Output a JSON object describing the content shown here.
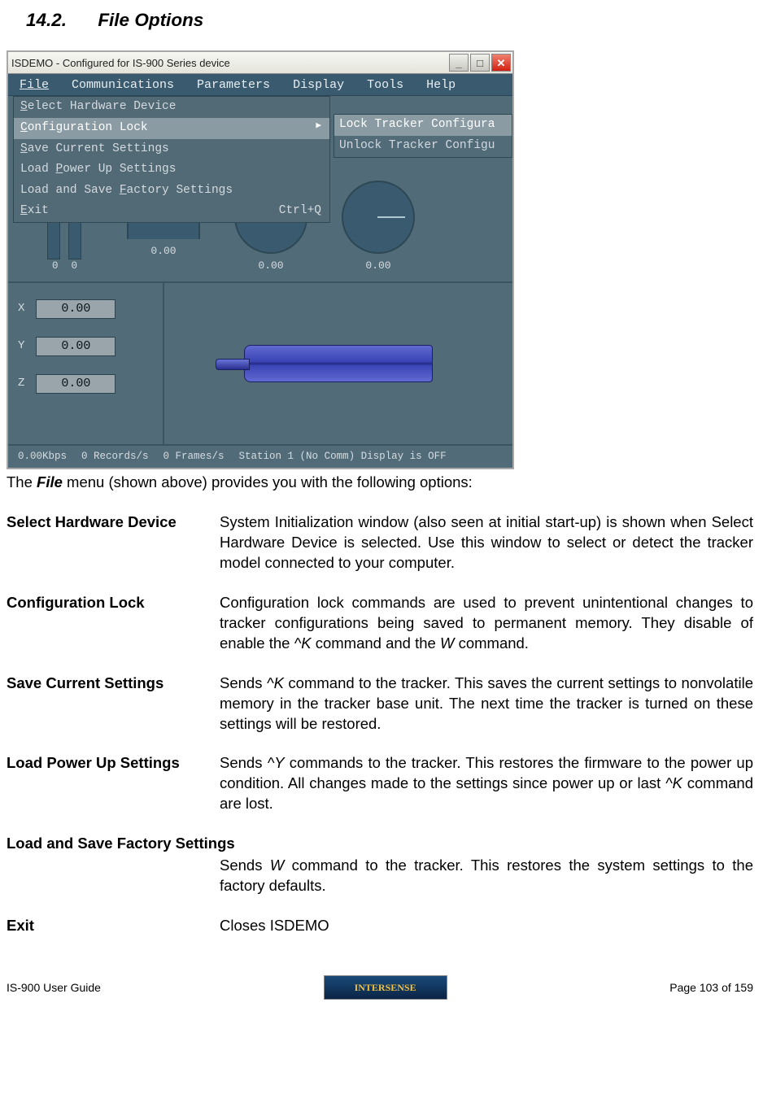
{
  "heading": {
    "number": "14.2.",
    "title": "File Options"
  },
  "window": {
    "title": "ISDEMO - Configured for IS-900 Series device",
    "menubar": [
      "File",
      "Communications",
      "Parameters",
      "Display",
      "Tools",
      "Help"
    ],
    "file_menu": [
      {
        "lead": "S",
        "rest": "elect Hardware Device",
        "shortcut": ""
      },
      {
        "lead": "C",
        "rest": "onfiguration Lock",
        "shortcut": "",
        "submenu": true,
        "selected": true
      },
      {
        "lead": "S",
        "rest": "ave Current Settings",
        "shortcut": ""
      },
      {
        "lead": "",
        "rest": "Load ",
        "lead2": "P",
        "rest2": "ower Up Settings",
        "shortcut": ""
      },
      {
        "lead": "",
        "rest": "Load and Save ",
        "lead2": "F",
        "rest2": "actory Settings",
        "shortcut": ""
      },
      {
        "lead": "E",
        "rest": "xit",
        "shortcut": "Ctrl+Q"
      }
    ],
    "submenu": [
      {
        "label": "Lock Tracker Configura",
        "selected": true
      },
      {
        "label": "Unlock Tracker Configu"
      }
    ],
    "bar_labels": [
      "0",
      "0"
    ],
    "dial_labels": [
      "0.00",
      "0.00",
      "0.00"
    ],
    "xyz": {
      "x_label": "X",
      "x_val": "0.00",
      "y_label": "Y",
      "y_val": "0.00",
      "z_label": "Z",
      "z_val": "0.00"
    },
    "status": [
      "0.00Kbps",
      "0 Records/s",
      "0 Frames/s",
      "Station 1 (No Comm) Display is OFF"
    ]
  },
  "caption": {
    "pre": "The ",
    "bold": "File",
    "post": " menu (shown above) provides you with the following options:"
  },
  "defs": {
    "select_hw": {
      "term": "Select Hardware Device",
      "body": "System Initialization window (also seen at initial start-up) is shown when Select Hardware Device is selected.  Use this window to select or detect the tracker model connected to your computer."
    },
    "config_lock": {
      "term": "Configuration Lock",
      "pre": "Configuration lock commands are used to prevent unintentional changes to tracker configurations being saved to permanent memory.  They disable of enable the ",
      "cmd1": "^K",
      "mid": " command and the ",
      "cmd2": "W",
      "post": " command."
    },
    "save_current": {
      "term": "Save Current Settings",
      "pre": "Sends ",
      "cmd": "^K",
      "post": " command to the tracker.  This saves the current settings to nonvolatile memory in the tracker base unit.  The next time the tracker is turned on these settings will be restored."
    },
    "load_power": {
      "term": "Load Power Up Settings",
      "pre": "Sends ",
      "cmd1": "^Y",
      "mid": " commands to the tracker.  This restores the firmware to the power up condition.  All changes made to the settings since power up or last ",
      "cmd2": "^K",
      "post": " command are lost."
    },
    "factory": {
      "term": "Load and Save Factory Settings",
      "pre": "Sends ",
      "cmd": "W",
      "post": " command to the tracker.  This restores the system settings to the factory defaults."
    },
    "exit": {
      "term": "Exit",
      "body": "Closes ISDEMO"
    }
  },
  "footer": {
    "left": "IS-900 User Guide",
    "right": "Page 103 of 159",
    "logo": "INTERSENSE"
  }
}
